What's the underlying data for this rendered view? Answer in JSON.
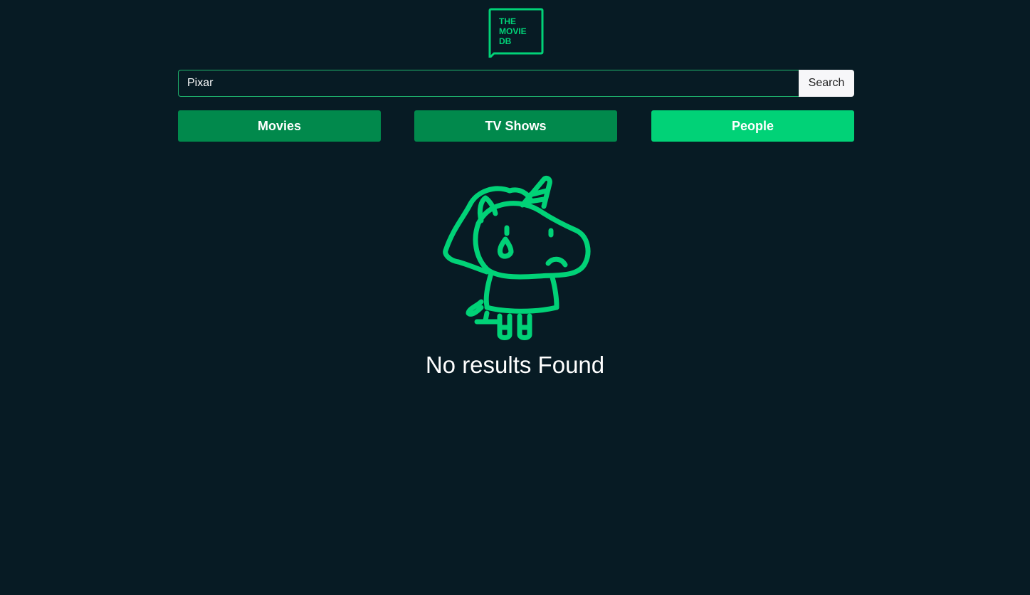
{
  "logo": {
    "icon": "tmdb-logo-icon",
    "text_lines": [
      "THE",
      "MOVIE",
      "DB"
    ],
    "color": "#01d277"
  },
  "search": {
    "value": "Pixar",
    "placeholder": "",
    "button_label": "Search"
  },
  "tabs": [
    {
      "label": "Movies",
      "active": false
    },
    {
      "label": "TV Shows",
      "active": false
    },
    {
      "label": "People",
      "active": true
    }
  ],
  "empty_state": {
    "icon": "crying-unicorn-icon",
    "message": "No results Found"
  },
  "colors": {
    "background": "#071b24",
    "accent": "#01d277",
    "tab_inactive": "#01894c",
    "tab_active": "#01d277",
    "text": "#ffffff"
  }
}
